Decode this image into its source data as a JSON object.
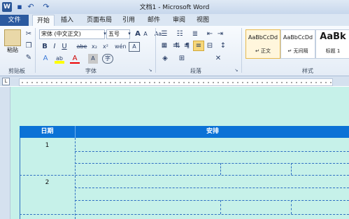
{
  "window": {
    "title": "文档1 - Microsoft Word",
    "app_icon": "W"
  },
  "quick_access": [
    {
      "name": "save-icon",
      "glyph": "▪"
    },
    {
      "name": "undo-icon",
      "glyph": "↶"
    },
    {
      "name": "redo-icon",
      "glyph": "↷"
    }
  ],
  "tabs": [
    {
      "label": "文件"
    },
    {
      "label": "开始"
    },
    {
      "label": "插入"
    },
    {
      "label": "页面布局"
    },
    {
      "label": "引用"
    },
    {
      "label": "邮件"
    },
    {
      "label": "审阅"
    },
    {
      "label": "视图"
    }
  ],
  "ribbon": {
    "clipboard": {
      "paste_label": "粘贴",
      "group_label": "剪贴板"
    },
    "font": {
      "font_name": "宋体 (中文正文)",
      "font_size": "五号",
      "group_label": "字体",
      "bold": "B",
      "italic": "I",
      "underline": "U",
      "strike": "abe",
      "sub": "x₂",
      "sup": "x²",
      "grow": "A",
      "shrink": "A",
      "clear": "Aa",
      "phonetic": "wén",
      "border": "A",
      "color_a": "A",
      "highlight": "ab",
      "shade": "A",
      "circle": "字"
    },
    "paragraph": {
      "group_label": "段落"
    },
    "styles": {
      "group_label": "样式",
      "items": [
        {
          "preview": "AaBbCcDd",
          "name": "↵ 正文"
        },
        {
          "preview": "AaBbCcDd",
          "name": "↵ 无间隔"
        },
        {
          "preview": "AaBk",
          "name": "标题 1"
        }
      ]
    }
  },
  "table": {
    "headers": [
      "日期",
      "安排"
    ],
    "rows": [
      "1",
      "2"
    ]
  },
  "colors": {
    "accent": "#2b5aa0",
    "table_header": "#0b72d6",
    "doc_bg": "#c6f1e9"
  }
}
